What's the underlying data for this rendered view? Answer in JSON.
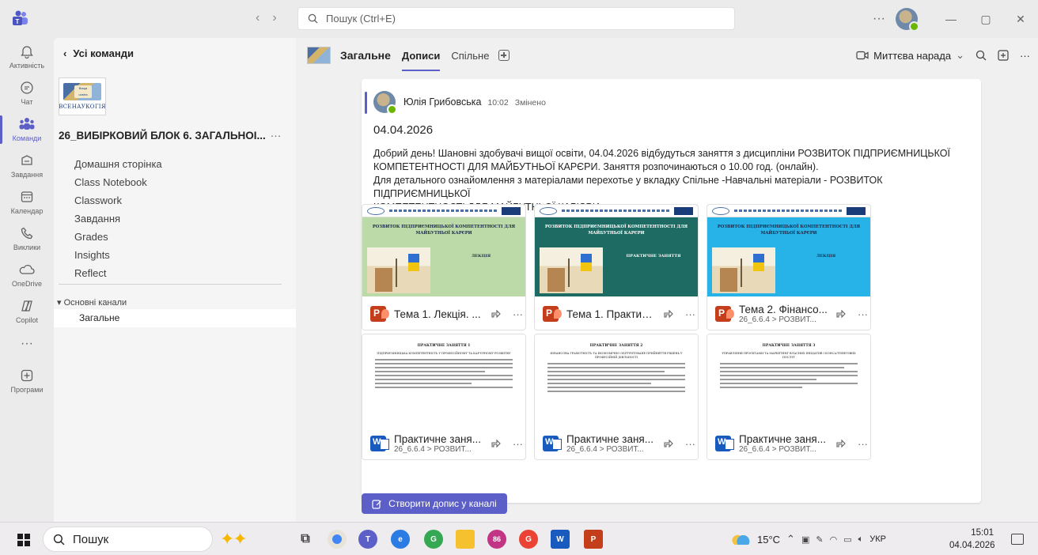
{
  "window": {
    "search_placeholder": "Пошук (Ctrl+E)",
    "more": "···",
    "minimize": "—",
    "maximize": "▢",
    "close": "✕"
  },
  "rail": {
    "items": [
      {
        "label": "Активність",
        "icon": "bell-icon"
      },
      {
        "label": "Чат",
        "icon": "chat-icon"
      },
      {
        "label": "Команди",
        "icon": "teams-icon"
      },
      {
        "label": "Завдання",
        "icon": "assignments-icon"
      },
      {
        "label": "Календар",
        "icon": "calendar-icon"
      },
      {
        "label": "Виклики",
        "icon": "phone-icon"
      },
      {
        "label": "OneDrive",
        "icon": "onedrive-icon"
      },
      {
        "label": "Copilot",
        "icon": "copilot-icon"
      },
      {
        "label": "···",
        "icon": "more-icon"
      },
      {
        "label": "Програми",
        "icon": "apps-icon"
      }
    ]
  },
  "left_panel": {
    "back_label": "Усі команди",
    "team_logo_text": "ВСЕНАУКОГІЯ",
    "team_logo_small": "Вища освіта",
    "team_name": "26_ВИБІРКОВИЙ БЛОК 6. ЗАГАЛЬНОІ...",
    "team_more": "···",
    "nav": [
      "Домашня сторінка",
      "Class Notebook",
      "Classwork",
      "Завдання",
      "Grades",
      "Insights",
      "Reflect"
    ],
    "channels_header": "Основні канали",
    "channels": [
      "Загальне"
    ]
  },
  "channel_header": {
    "title": "Загальне",
    "tabs": [
      "Дописи",
      "Спільне"
    ],
    "meet_now": "Миттєва нарада"
  },
  "post": {
    "author": "Юлія Грибовська",
    "time": "10:02",
    "edited": "Змінено",
    "title": "04.04.2026",
    "body_lines": [
      "Добрий день! Шановні здобувачі вищої освіти, 04.04.2026 відбудуться заняття з дисципліни РОЗВИТОК ПІДПРИЄМНИЦЬКОЇ",
      "КОМПЕТЕНТНОСТІ ДЛЯ МАЙБУТНЬОЇ КАРЄРИ. Заняття розпочинаються о 10.00 год. (онлайн).",
      "Для детального ознайомлення з матеріалами перехотье у вкладку Спільне -Навчальні матеріали - РОЗВИТОК ПІДПРИЄМНИЦЬКОЇ",
      "КОМПЕТЕНТНОСТІ ДЛЯ МАЙБУТНЬОЇ КАР'ЄРИ"
    ],
    "attachments": [
      {
        "name": "Тема 1. Лекція. ...",
        "path": "",
        "type": "ppt",
        "slide_bg": "#bcd9a8",
        "slide_title": "РОЗВИТОК ПІДПРИЄМНИЦЬКОЇ КОМПЕТЕНТНОСТІ ДЛЯ МАЙБУТНЬОЇ КАРЄРИ",
        "slide_word": "ЛЕКЦІЯ"
      },
      {
        "name": "Тема 1. Практич...",
        "path": "",
        "type": "ppt",
        "slide_bg": "#1e6b63",
        "slide_title": "РОЗВИТОК ПІДПРИЄМНИЦЬКОЇ КОМПЕТЕНТНОСТІ ДЛЯ МАЙБУТНЬОЇ КАРЄРИ",
        "slide_word": "ПРАКТИЧНЕ ЗАНЯТТЯ"
      },
      {
        "name": "Тема 2. Фінансо...",
        "path": "26_6.6.4 > РОЗВИТ...",
        "type": "ppt",
        "slide_bg": "#27b3e8",
        "slide_title": "РОЗВИТОК ПІДПРИЄМНИЦЬКОЇ КОМПЕТЕНТНОСТІ ДЛЯ МАЙБУТНЬОЇ КАРЄРИ",
        "slide_word": "ЛЕКЦІЯ"
      },
      {
        "name": "Практичне заня...",
        "path": "26_6.6.4 > РОЗВИТ...",
        "type": "doc",
        "doc_title": "ПРАКТИЧНЕ ЗАНЯТТЯ 1",
        "doc_sub": "ПІДПРИЄМНИЦЬКА КОМПЕТЕНТНІСТЬ У ПРОФЕСІЙНОМУ ТА КАР'ЄРНОМУ РОЗВИТКУ"
      },
      {
        "name": "Практичне заня...",
        "path": "26_6.6.4 > РОЗВИТ...",
        "type": "doc",
        "doc_title": "ПРАКТИЧНЕ ЗАНЯТТЯ 2",
        "doc_sub": "ФІНАНСОВА ГРАМОТНІСТЬ ТА ЕКОНОМІЧНО ОБҐРУНТОВАНЕ ПРИЙНЯТТЯ РІШЕНЬ У ПРОФЕСІЙНІЙ ДІЯЛЬНОСТІ"
      },
      {
        "name": "Практичне заня...",
        "path": "26_6.6.4 > РОЗВИТ...",
        "type": "doc",
        "doc_title": "ПРАКТИЧНЕ ЗАНЯТТЯ 3",
        "doc_sub": "УПРАВЛІННЯ ПРОЄКТАМИ ТА МАРКЕТИНГ ВЛАСНИХ ІНІЦІАТИВ І КОНСАЛТИНГОВИХ ПОСЛУГ"
      }
    ]
  },
  "create_post": "Створити допис у каналі",
  "taskbar": {
    "search": "Пошук",
    "weather": "15°C",
    "lang": "УКР",
    "time": "15:01",
    "date": "04.04.2026",
    "badges": {
      "mail_count": "86"
    }
  }
}
